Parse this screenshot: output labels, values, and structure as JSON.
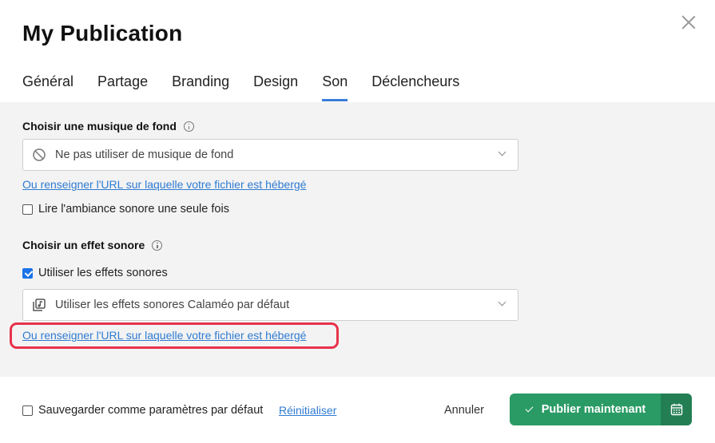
{
  "dialog": {
    "title": "My Publication"
  },
  "tabs": [
    {
      "label": "Général",
      "active": false
    },
    {
      "label": "Partage",
      "active": false
    },
    {
      "label": "Branding",
      "active": false
    },
    {
      "label": "Design",
      "active": false
    },
    {
      "label": "Son",
      "active": true
    },
    {
      "label": "Déclencheurs",
      "active": false
    }
  ],
  "music": {
    "section_title": "Choisir une musique de fond",
    "select_value": "Ne pas utiliser de musique de fond",
    "select_icon": "no-entry-icon",
    "url_link": "Ou renseigner l'URL sur laquelle votre fichier est hébergé",
    "play_once_label": "Lire l'ambiance sonore une seule fois",
    "play_once_checked": false
  },
  "effects": {
    "section_title": "Choisir un effet sonore",
    "use_effects_label": "Utiliser les effets sonores",
    "use_effects_checked": true,
    "select_value": "Utiliser les effets sonores Calaméo par défaut",
    "select_icon": "music-library-icon",
    "url_link": "Ou renseigner l'URL sur laquelle votre fichier est hébergé"
  },
  "footer": {
    "save_default_label": "Sauvegarder comme paramètres par défaut",
    "save_default_checked": false,
    "reset_label": "Réinitialiser",
    "cancel_label": "Annuler",
    "publish_label": "Publier maintenant"
  },
  "colors": {
    "accent": "#3b7ed8",
    "link": "#2f7bd1",
    "publish": "#2a9b65",
    "publish_dark": "#237f53",
    "highlight": "#e8324a"
  }
}
